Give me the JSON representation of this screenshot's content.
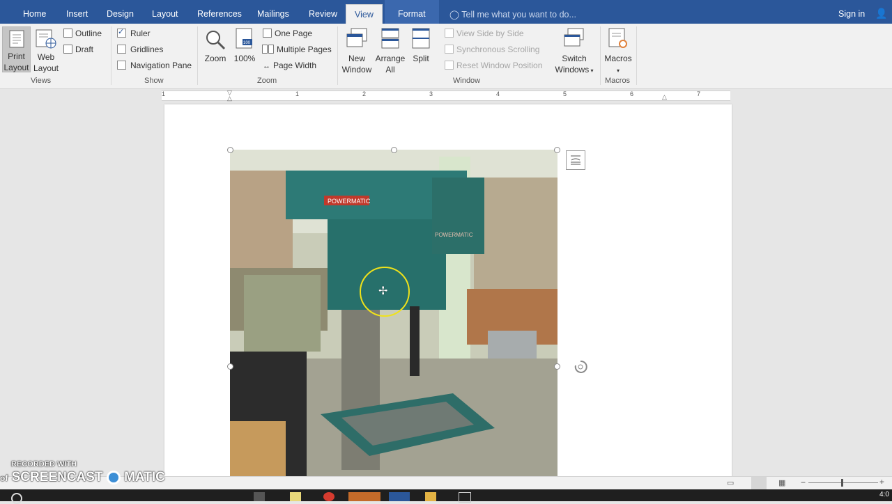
{
  "tabs": [
    "Home",
    "Insert",
    "Design",
    "Layout",
    "References",
    "Mailings",
    "Review",
    "View",
    "Format"
  ],
  "active_tab": "View",
  "tell_me": "Tell me what you want to do...",
  "sign_in": "Sign in",
  "ribbon": {
    "views": {
      "print_layout": [
        "Print",
        "Layout"
      ],
      "web_layout": [
        "Web",
        "Layout"
      ],
      "outline": "Outline",
      "draft": "Draft",
      "label": "Views"
    },
    "show": {
      "ruler": "Ruler",
      "ruler_checked": true,
      "gridlines": "Gridlines",
      "gridlines_checked": false,
      "navigation_pane": "Navigation Pane",
      "navigation_pane_checked": false,
      "label": "Show"
    },
    "zoom": {
      "zoom": "Zoom",
      "hundred": "100%",
      "one_page": "One Page",
      "multiple_pages": "Multiple Pages",
      "page_width": "Page Width",
      "label": "Zoom"
    },
    "window": {
      "new_window": [
        "New",
        "Window"
      ],
      "arrange_all": [
        "Arrange",
        "All"
      ],
      "split": "Split",
      "view_side_by_side": "View Side by Side",
      "synchronous_scrolling": "Synchronous Scrolling",
      "reset_window_position": "Reset Window Position",
      "switch_windows": [
        "Switch",
        "Windows"
      ],
      "label": "Window"
    },
    "macros": {
      "macros": "Macros",
      "label": "Macros"
    }
  },
  "ruler_numbers": [
    "1",
    "1",
    "2",
    "3",
    "4",
    "5",
    "6",
    "7"
  ],
  "image": {
    "brand_top": "POWERMATIC",
    "brand_side": "POWERMATIC"
  },
  "watermark": {
    "recorded_with": "RECORDED WITH",
    "screencast": "SCREENCAST",
    "matic": "MATIC",
    "prefix": "of"
  },
  "clock": "4:0",
  "colors": {
    "ribbon_blue": "#2b579a",
    "ribbon_bg": "#f1f1f1",
    "cursor_ring": "#f0e21a"
  }
}
